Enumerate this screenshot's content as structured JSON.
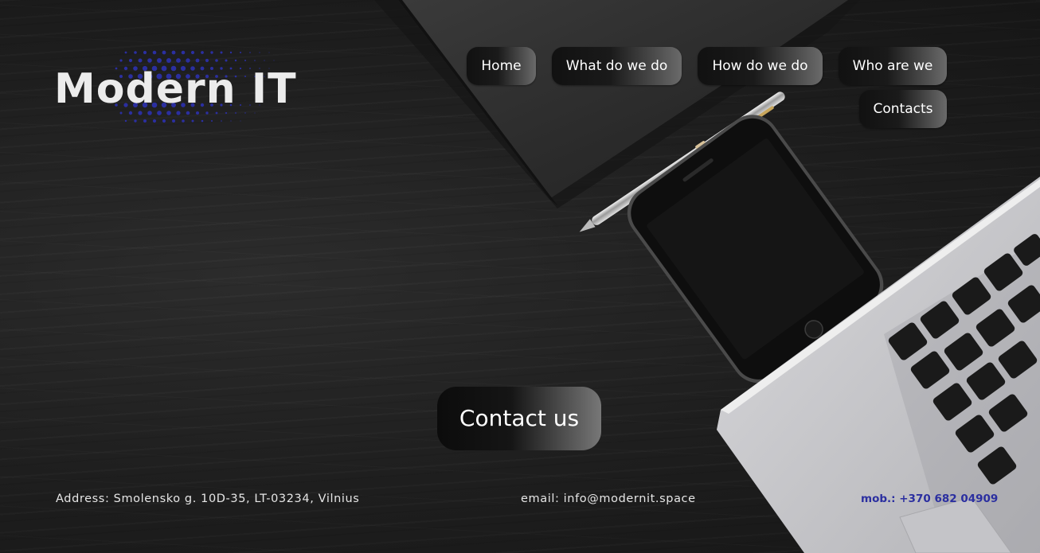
{
  "brand": {
    "logo_text": "Modern IT",
    "accent": "#2b2fa0"
  },
  "nav": {
    "items": [
      {
        "label": "Home"
      },
      {
        "label": "What do we do"
      },
      {
        "label": "How do we do"
      },
      {
        "label": "Who are we"
      },
      {
        "label": "Contacts"
      }
    ]
  },
  "hero": {
    "cta_label": "Contact us"
  },
  "footer": {
    "address": "Address: Smolensko g. 10D-35, LT-03234, Vilnius",
    "email": "email: info@modernit.space",
    "mobile_label": "mob.:",
    "mobile_number": "+370 682 04909"
  },
  "background": {
    "objects": [
      "notebook",
      "pen",
      "smartphone",
      "laptop"
    ]
  }
}
